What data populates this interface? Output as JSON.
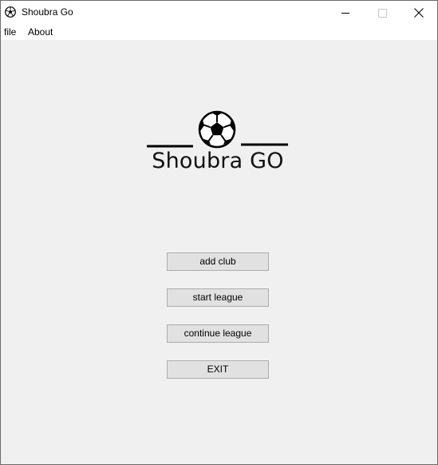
{
  "window": {
    "title": "Shoubra Go",
    "icon": "soccer-ball-icon"
  },
  "menu": {
    "items": [
      {
        "label": "file"
      },
      {
        "label": "About"
      }
    ]
  },
  "logo": {
    "text": "Shoubra GO",
    "icon": "soccer-ball-icon"
  },
  "buttons": {
    "add_club": "add club",
    "start_league": "start league",
    "continue_league": "continue league",
    "exit": "EXIT"
  },
  "colors": {
    "client_background": "#f0f0f0",
    "button_background": "#e1e1e1",
    "button_border": "#adadad"
  }
}
